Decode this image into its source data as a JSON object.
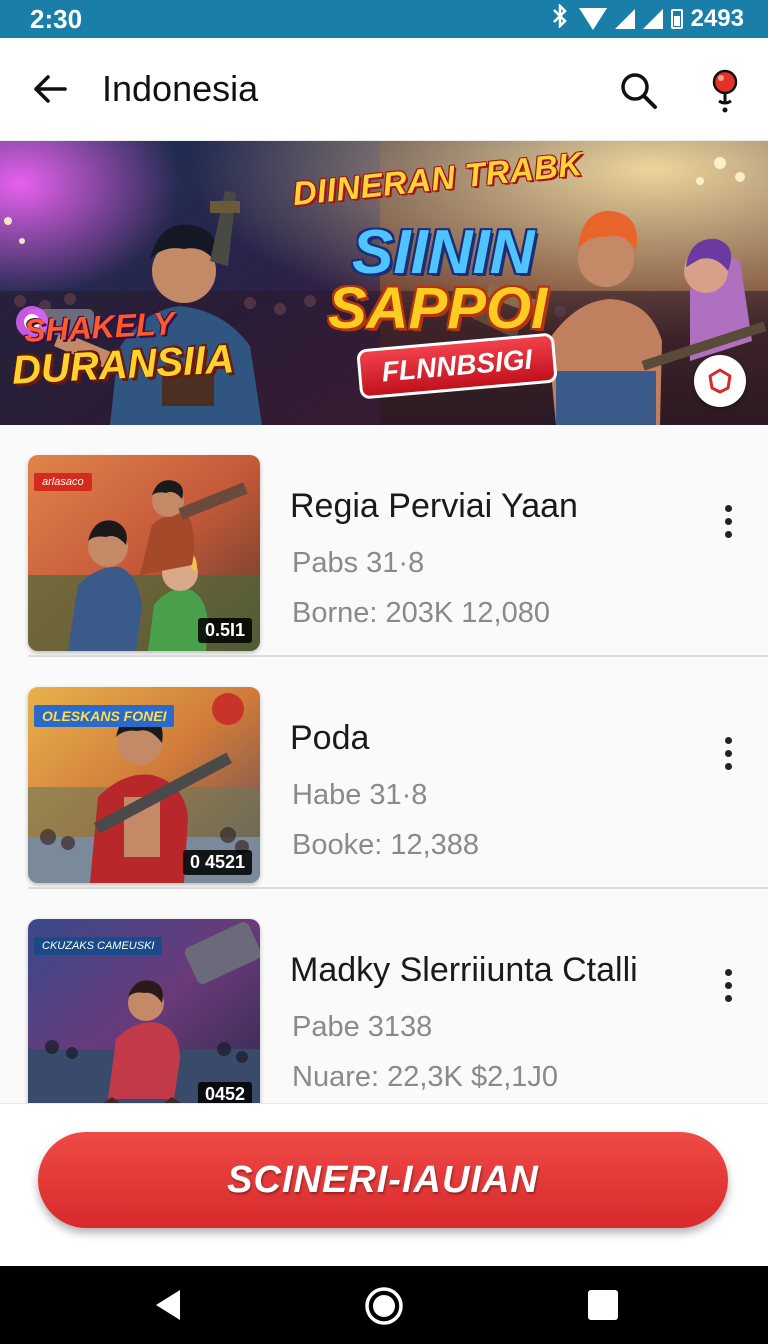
{
  "status_bar": {
    "time": "2:30",
    "battery_text": "2493",
    "icons": [
      "bluetooth-icon",
      "wifi-icon",
      "signal-icon",
      "signal-icon",
      "battery-icon"
    ]
  },
  "app_bar": {
    "title": "Indonesia",
    "back_icon": "arrow-left-icon",
    "search_icon": "search-icon",
    "location_icon": "map-pin-icon"
  },
  "banner": {
    "headline_top": "DIINERAN TRABK",
    "headline_mid": "SIININ",
    "headline_bottom": "SAPPOI",
    "pill_label": "FLNNBSIGI",
    "left_line_1": "SHAKELY",
    "left_line_2": "DURANSIIA",
    "fab_icon": "shield-icon"
  },
  "list": {
    "items": [
      {
        "title": "Regia Perviai Yaan",
        "line1": "Pabs 31·8",
        "line2": "Borne: 203K 12,080",
        "badge": "0.5I1",
        "tag": "arlasaco",
        "more_icon": "more-vertical-icon"
      },
      {
        "title": "Poda",
        "line1": "Habe 31·8",
        "line2": "Booke: 12,388",
        "badge": "0 4521",
        "tag": "OLESKANS FONEI",
        "more_icon": "more-vertical-icon"
      },
      {
        "title": "Madky Slerriiunta Ctalli",
        "line1": "Pabe 3138",
        "line2": "Nuare: 22,3K $2,1Ј0",
        "badge": "0452",
        "tag": "CKUZAKS CAMEUSKI",
        "more_icon": "more-vertical-icon"
      }
    ]
  },
  "cta": {
    "label": "SCINERI-IAUIAN"
  },
  "nav_bar": {
    "back_icon": "nav-back-icon",
    "home_icon": "nav-home-icon",
    "recents_icon": "nav-recents-icon"
  },
  "colors": {
    "status_bar": "#1a7fa8",
    "cta": "#e0373a",
    "text_primary": "#1a1a1a",
    "text_secondary": "#8a8a8a"
  }
}
